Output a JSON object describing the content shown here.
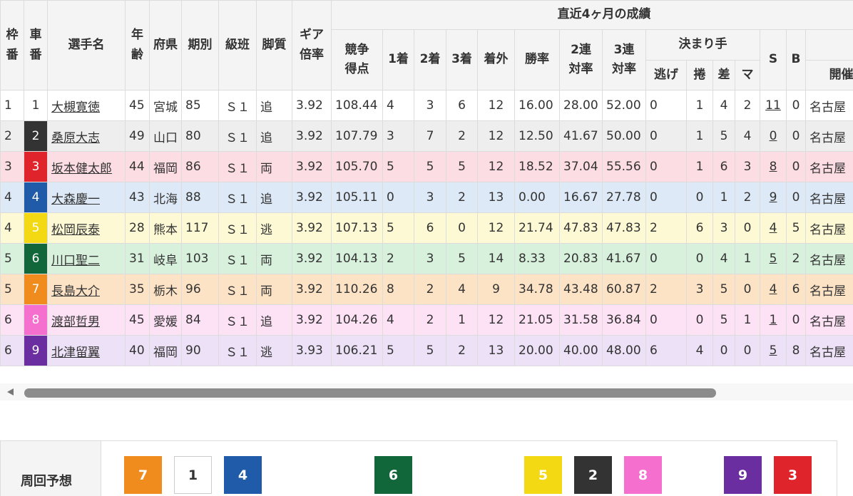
{
  "headers": {
    "waku": "枠番",
    "sha": "車番",
    "name": "選手名",
    "age": "年齢",
    "pref": "府県",
    "term": "期別",
    "class": "級班",
    "style": "脚質",
    "gear": "ギア倍率",
    "recent": "直近4ヶ月の成績",
    "score": "競争得点",
    "first": "1着",
    "second": "2着",
    "third": "3着",
    "out": "着外",
    "win_rate": "勝率",
    "rate2": "2連対率",
    "rate3": "3連対率",
    "kimarite": "決まり手",
    "nige": "逃げ",
    "makuri": "捲",
    "sashi": "差",
    "ma": "マ",
    "s": "S",
    "b": "B",
    "venue": "開催"
  },
  "rows": [
    {
      "waku": "1",
      "car": "1",
      "name": "大槻寛徳",
      "age": "45",
      "pref": "宮城",
      "term": "85",
      "cls": "Ｓ１",
      "style": "追",
      "gear": "3.92",
      "score": "108.44",
      "f1": "4",
      "f2": "3",
      "f3": "6",
      "out": "12",
      "win": "16.00",
      "r2": "28.00",
      "r3": "52.00",
      "nige": "0",
      "makuri": "1",
      "sashi": "4",
      "ma": "2",
      "s": "11",
      "b": "0",
      "venue": "名古屋",
      "row_bg": "#ffffff",
      "car_bg": "#ffffff",
      "car_fg": "#333333"
    },
    {
      "waku": "2",
      "car": "2",
      "name": "桑原大志",
      "age": "49",
      "pref": "山口",
      "term": "80",
      "cls": "Ｓ１",
      "style": "追",
      "gear": "3.92",
      "score": "107.79",
      "f1": "3",
      "f2": "7",
      "f3": "2",
      "out": "12",
      "win": "12.50",
      "r2": "41.67",
      "r3": "50.00",
      "nige": "0",
      "makuri": "1",
      "sashi": "5",
      "ma": "4",
      "s": "0",
      "b": "0",
      "venue": "名古屋",
      "row_bg": "#eeeeee",
      "car_bg": "#333333",
      "car_fg": "#ffffff"
    },
    {
      "waku": "3",
      "car": "3",
      "name": "坂本健太郎",
      "age": "44",
      "pref": "福岡",
      "term": "86",
      "cls": "Ｓ１",
      "style": "両",
      "gear": "3.92",
      "score": "105.70",
      "f1": "5",
      "f2": "5",
      "f3": "5",
      "out": "12",
      "win": "18.52",
      "r2": "37.04",
      "r3": "55.56",
      "nige": "0",
      "makuri": "1",
      "sashi": "6",
      "ma": "3",
      "s": "8",
      "b": "0",
      "venue": "名古屋",
      "row_bg": "#fcdde3",
      "car_bg": "#e0242b",
      "car_fg": "#ffffff"
    },
    {
      "waku": "4",
      "car": "4",
      "name": "大森慶一",
      "age": "43",
      "pref": "北海",
      "term": "88",
      "cls": "Ｓ１",
      "style": "追",
      "gear": "3.92",
      "score": "105.11",
      "f1": "0",
      "f2": "3",
      "f3": "2",
      "out": "13",
      "win": "0.00",
      "r2": "16.67",
      "r3": "27.78",
      "nige": "0",
      "makuri": "0",
      "sashi": "1",
      "ma": "2",
      "s": "9",
      "b": "0",
      "venue": "名古屋",
      "row_bg": "#dde9f6",
      "car_bg": "#1f5ba8",
      "car_fg": "#ffffff"
    },
    {
      "waku": "4",
      "car": "5",
      "name": "松岡辰泰",
      "age": "28",
      "pref": "熊本",
      "term": "117",
      "cls": "Ｓ１",
      "style": "逃",
      "gear": "3.92",
      "score": "107.13",
      "f1": "5",
      "f2": "6",
      "f3": "0",
      "out": "12",
      "win": "21.74",
      "r2": "47.83",
      "r3": "47.83",
      "nige": "2",
      "makuri": "6",
      "sashi": "3",
      "ma": "0",
      "s": "4",
      "b": "5",
      "venue": "名古屋",
      "row_bg": "#fdf9d4",
      "car_bg": "#f3d814",
      "car_fg": "#ffffff"
    },
    {
      "waku": "5",
      "car": "6",
      "name": "川口聖二",
      "age": "31",
      "pref": "岐阜",
      "term": "103",
      "cls": "Ｓ１",
      "style": "両",
      "gear": "3.92",
      "score": "104.13",
      "f1": "2",
      "f2": "3",
      "f3": "5",
      "out": "14",
      "win": "8.33",
      "r2": "20.83",
      "r3": "41.67",
      "nige": "0",
      "makuri": "0",
      "sashi": "4",
      "ma": "1",
      "s": "5",
      "b": "2",
      "venue": "名古屋",
      "row_bg": "#d8f1dc",
      "car_bg": "#11663a",
      "car_fg": "#ffffff"
    },
    {
      "waku": "5",
      "car": "7",
      "name": "長島大介",
      "age": "35",
      "pref": "栃木",
      "term": "96",
      "cls": "Ｓ１",
      "style": "両",
      "gear": "3.92",
      "score": "110.26",
      "f1": "8",
      "f2": "2",
      "f3": "4",
      "out": "9",
      "win": "34.78",
      "r2": "43.48",
      "r3": "60.87",
      "nige": "2",
      "makuri": "3",
      "sashi": "5",
      "ma": "0",
      "s": "4",
      "b": "6",
      "venue": "名古屋",
      "row_bg": "#fde3c6",
      "car_bg": "#f08b1d",
      "car_fg": "#ffffff"
    },
    {
      "waku": "6",
      "car": "8",
      "name": "渡部哲男",
      "age": "45",
      "pref": "愛媛",
      "term": "84",
      "cls": "Ｓ１",
      "style": "追",
      "gear": "3.92",
      "score": "104.26",
      "f1": "4",
      "f2": "2",
      "f3": "1",
      "out": "12",
      "win": "21.05",
      "r2": "31.58",
      "r3": "36.84",
      "nige": "0",
      "makuri": "0",
      "sashi": "5",
      "ma": "1",
      "s": "1",
      "b": "0",
      "venue": "名古屋",
      "row_bg": "#fde2f6",
      "car_bg": "#f56fcf",
      "car_fg": "#ffffff"
    },
    {
      "waku": "6",
      "car": "9",
      "name": "北津留翼",
      "age": "40",
      "pref": "福岡",
      "term": "90",
      "cls": "Ｓ１",
      "style": "逃",
      "gear": "3.93",
      "score": "106.21",
      "f1": "5",
      "f2": "5",
      "f3": "2",
      "out": "13",
      "win": "20.00",
      "r2": "40.00",
      "r3": "48.00",
      "nige": "6",
      "makuri": "4",
      "sashi": "0",
      "ma": "0",
      "s": "5",
      "b": "8",
      "venue": "名古屋",
      "row_bg": "#ece1f6",
      "car_bg": "#6b2ea0",
      "car_fg": "#ffffff"
    }
  ],
  "prediction": {
    "label": "周回予想",
    "chips": [
      {
        "num": "7",
        "bg": "#f08b1d",
        "fg": "#ffffff",
        "border": "#f08b1d"
      },
      {
        "num": "1",
        "bg": "#ffffff",
        "fg": "#333333",
        "border": "#cccccc"
      },
      {
        "num": "4",
        "bg": "#1f5ba8",
        "fg": "#ffffff",
        "border": "#1f5ba8"
      },
      {
        "num": "6",
        "bg": "#11663a",
        "fg": "#ffffff",
        "border": "#11663a"
      },
      {
        "num": "5",
        "bg": "#f3d814",
        "fg": "#ffffff",
        "border": "#f3d814"
      },
      {
        "num": "2",
        "bg": "#333333",
        "fg": "#ffffff",
        "border": "#333333"
      },
      {
        "num": "8",
        "bg": "#f56fcf",
        "fg": "#ffffff",
        "border": "#f56fcf"
      },
      {
        "num": "9",
        "bg": "#6b2ea0",
        "fg": "#ffffff",
        "border": "#6b2ea0"
      },
      {
        "num": "3",
        "bg": "#e0242b",
        "fg": "#ffffff",
        "border": "#e0242b"
      }
    ]
  }
}
